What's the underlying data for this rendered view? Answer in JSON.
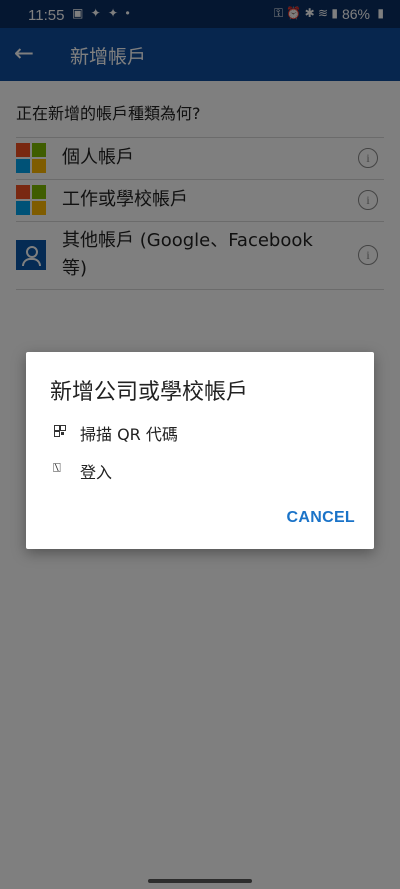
{
  "status_bar": {
    "time": "11:55",
    "notif_icons": "▣ ✦ ✦ •",
    "battery": "86%",
    "sys_icons": "⚿ ⏰ ✱ ≋ ▮"
  },
  "app_bar": {
    "title": "新增帳戶",
    "back_icon": "←"
  },
  "prompt": "正在新增的帳戶種類為何?",
  "account_types": [
    {
      "label": "個人帳戶",
      "logo": "microsoft-logo"
    },
    {
      "label": "工作或學校帳戶",
      "logo": "microsoft-logo"
    },
    {
      "label_line1": "其他帳戶 (Google、Facebook",
      "label_line2": "等)",
      "logo": "person-icon"
    }
  ],
  "info_glyph": "i",
  "dialog": {
    "title": "新增公司或學校帳戶",
    "options": [
      {
        "label": "掃描 QR 代碼",
        "icon": "qr-code-icon"
      },
      {
        "label": "登入",
        "icon": "sign-in-icon",
        "glyph": "⍂"
      }
    ],
    "cancel_label": "CANCEL"
  },
  "colors": {
    "app_bar": "#0f4c9c",
    "status_bar": "#0a2f63",
    "accent": "#1a73c8"
  }
}
